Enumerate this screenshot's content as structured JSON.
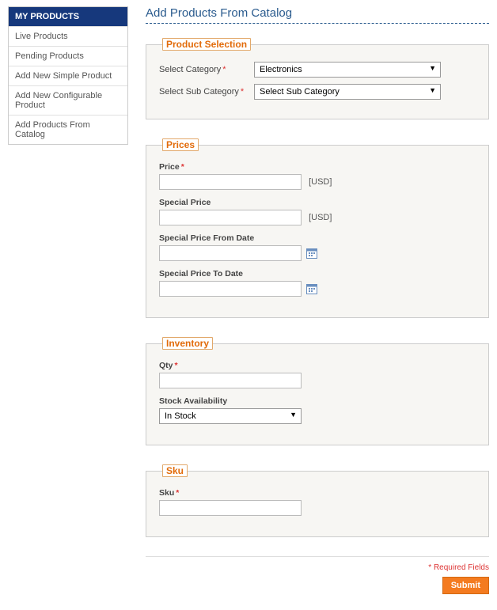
{
  "sidebar": {
    "header": "MY PRODUCTS",
    "items": [
      {
        "label": "Live Products"
      },
      {
        "label": "Pending Products"
      },
      {
        "label": "Add New Simple Product"
      },
      {
        "label": "Add New Configurable Product"
      },
      {
        "label": "Add Products From Catalog"
      }
    ]
  },
  "page": {
    "title": "Add Products From Catalog"
  },
  "sections": {
    "product_selection": {
      "legend": "Product Selection",
      "select_category": {
        "label": "Select Category",
        "value": "Electronics"
      },
      "select_sub_category": {
        "label": "Select Sub Category",
        "value": "Select Sub Category"
      }
    },
    "prices": {
      "legend": "Prices",
      "price": {
        "label": "Price",
        "value": "",
        "unit": "[USD]"
      },
      "special_price": {
        "label": "Special Price",
        "value": "",
        "unit": "[USD]"
      },
      "special_from": {
        "label": "Special Price From Date",
        "value": ""
      },
      "special_to": {
        "label": "Special Price To Date",
        "value": ""
      }
    },
    "inventory": {
      "legend": "Inventory",
      "qty": {
        "label": "Qty",
        "value": ""
      },
      "stock": {
        "label": "Stock Availability",
        "value": "In Stock"
      }
    },
    "sku": {
      "legend": "Sku",
      "sku": {
        "label": "Sku",
        "value": ""
      }
    }
  },
  "footer": {
    "required_note": "* Required Fields",
    "submit": "Submit"
  }
}
